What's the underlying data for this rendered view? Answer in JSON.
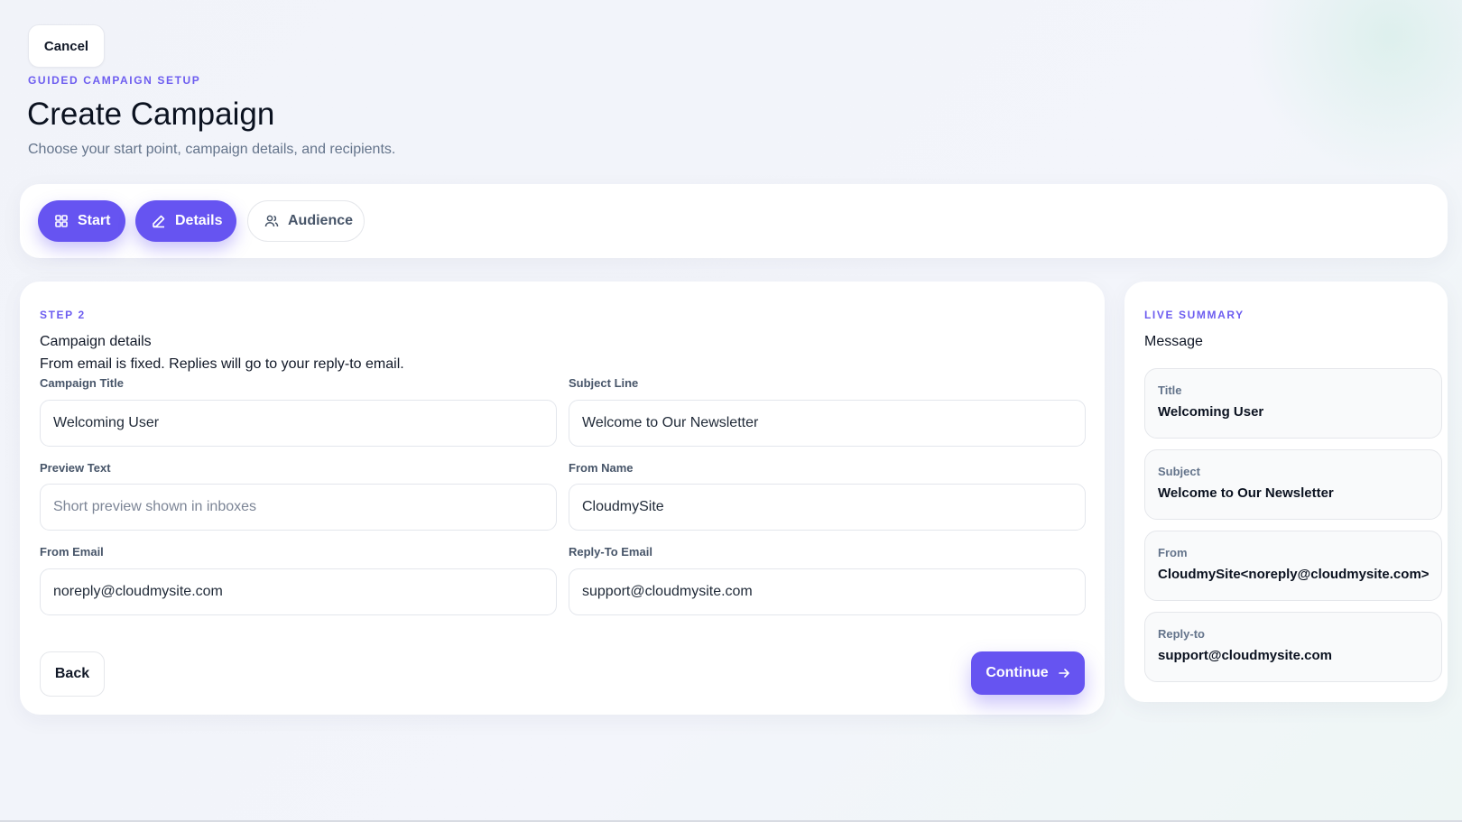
{
  "header": {
    "cancel_label": "Cancel",
    "eyebrow": "GUIDED CAMPAIGN SETUP",
    "title": "Create Campaign",
    "subtitle": "Choose your start point, campaign details, and recipients."
  },
  "steps": [
    {
      "label": "Start",
      "icon": "grid-icon",
      "state": "completed"
    },
    {
      "label": "Details",
      "icon": "pencil-icon",
      "state": "active"
    },
    {
      "label": "Audience",
      "icon": "users-icon",
      "state": "upcoming"
    }
  ],
  "form": {
    "eyebrow": "STEP 2",
    "title": "Campaign details",
    "description": "From email is fixed. Replies will go to your reply-to email.",
    "fields": {
      "campaign_title": {
        "label": "Campaign Title",
        "value": "Welcoming User",
        "placeholder": ""
      },
      "subject_line": {
        "label": "Subject Line",
        "value": "Welcome to Our Newsletter",
        "placeholder": ""
      },
      "preview_text": {
        "label": "Preview Text",
        "value": "",
        "placeholder": "Short preview shown in inboxes"
      },
      "from_name": {
        "label": "From Name",
        "value": "CloudmySite",
        "placeholder": ""
      },
      "from_email": {
        "label": "From Email",
        "value": "noreply@cloudmysite.com",
        "placeholder": ""
      },
      "reply_to_email": {
        "label": "Reply-To Email",
        "value": "support@cloudmysite.com",
        "placeholder": ""
      }
    },
    "back_label": "Back",
    "continue_label": "Continue"
  },
  "summary": {
    "eyebrow": "LIVE SUMMARY",
    "heading": "Message",
    "items": [
      {
        "key": "Title",
        "value": "Welcoming User"
      },
      {
        "key": "Subject",
        "value": "Welcome to Our Newsletter"
      },
      {
        "key": "From",
        "value": "CloudmySite<noreply@cloudmysite.com>"
      },
      {
        "key": "Reply-to",
        "value": "support@cloudmysite.com"
      }
    ]
  },
  "colors": {
    "accent": "#6654f1",
    "eyebrow": "#6d5df0",
    "muted_text": "#64748b"
  }
}
